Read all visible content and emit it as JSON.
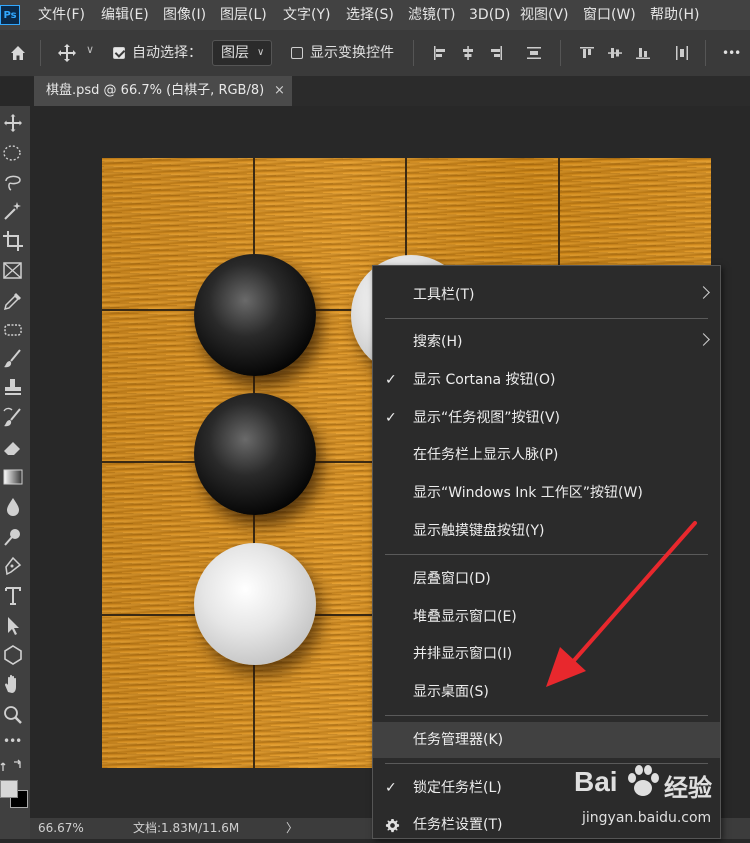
{
  "app": {
    "logo": "Ps"
  },
  "menubar": {
    "items": [
      "文件(F)",
      "编辑(E)",
      "图像(I)",
      "图层(L)",
      "文字(Y)",
      "选择(S)",
      "滤镜(T)",
      "3D(D)",
      "视图(V)",
      "窗口(W)",
      "帮助(H)"
    ]
  },
  "options": {
    "auto_select_label": "自动选择：",
    "auto_select_value": "图层",
    "show_transform_label": "显示变换控件",
    "more": "•••"
  },
  "tab": {
    "title": "棋盘.psd @ 66.7% (白棋子, RGB/8)",
    "close": "×"
  },
  "status": {
    "zoom": "66.67%",
    "doc": "文档:1.83M/11.6M",
    "chevron": "〉"
  },
  "context_menu": {
    "items": [
      {
        "label": "工具栏(T)",
        "submenu": true
      },
      {
        "label": "搜索(H)",
        "submenu": true
      },
      {
        "label": "显示 Cortana 按钮(O)",
        "checked": true
      },
      {
        "label": "显示“任务视图”按钮(V)",
        "checked": true
      },
      {
        "label": "在任务栏上显示人脉(P)"
      },
      {
        "label": "显示“Windows Ink 工作区”按钮(W)"
      },
      {
        "label": "显示触摸键盘按钮(Y)"
      },
      {
        "label": "层叠窗口(D)"
      },
      {
        "label": "堆叠显示窗口(E)"
      },
      {
        "label": "并排显示窗口(I)"
      },
      {
        "label": "显示桌面(S)"
      },
      {
        "label": "任务管理器(K)",
        "highlighted": true
      },
      {
        "label": "锁定任务栏(L)",
        "checked": true
      },
      {
        "label": "任务栏设置(T)",
        "icon": "gear-icon"
      }
    ],
    "check_glyph": "✓"
  },
  "watermark": {
    "brand": "Bai",
    "brand2": "经验",
    "url": "jingyan.baidu.com"
  },
  "colors": {
    "accent": "#31a8ff",
    "arrow": "#e8282d",
    "board": "#d8921f"
  }
}
